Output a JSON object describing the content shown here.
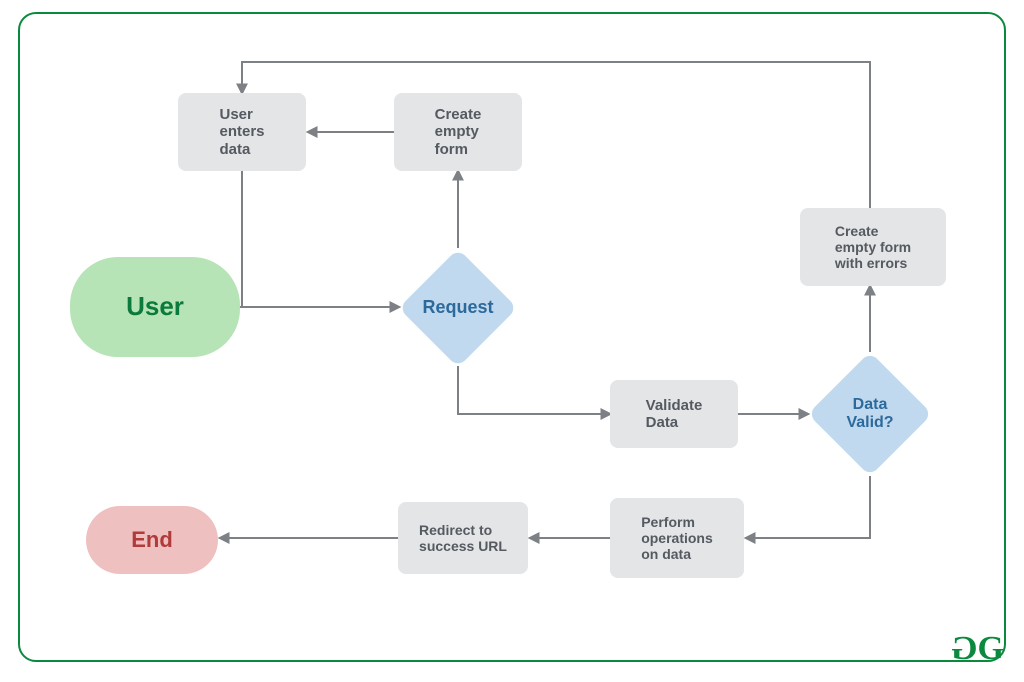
{
  "flow": {
    "start": "User",
    "end": "End",
    "user_enters": "User\nenters\ndata",
    "create_empty": "Create\nempty\nform",
    "request": "Request",
    "validate": "Validate\nData",
    "data_valid": "Data\nValid?",
    "create_errors": "Create\nempty form\nwith errors",
    "perform": "Perform\noperations\non data",
    "redirect": "Redirect to\nsuccess URL"
  },
  "colors": {
    "border": "#0b8a3f",
    "start_bg": "#b6e4b6",
    "start_text": "#0c7a3d",
    "end_bg": "#efc0c0",
    "end_text": "#b13a3a",
    "proc_bg": "#e3e5e7",
    "proc_text": "#555a60",
    "decision_bg": "#c0d9ee",
    "decision_text": "#2d6a9c",
    "connector": "#7d8084"
  },
  "brand": "GeeksforGeeks"
}
